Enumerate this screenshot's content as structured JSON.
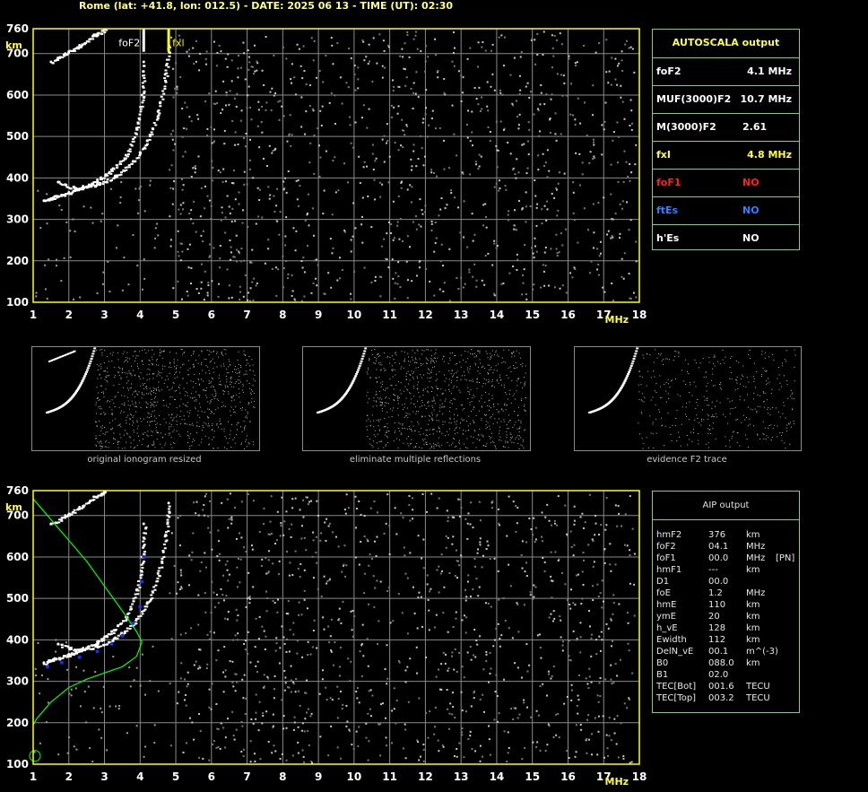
{
  "header": "Rome (lat: +41.8, lon: 012.5) - DATE: 2025 06 13 - TIME (UT): 02:30",
  "colors": {
    "frame": "#ffff00",
    "grid": "#8a8a8a",
    "trace": "#ffffff",
    "profile": "#00ff00",
    "blue": "#1a2cff",
    "table_border": "#7fd07f",
    "title": "#ffff40"
  },
  "chart_data": [
    {
      "type": "scatter",
      "name": "top-ionogram",
      "xlabel": "MHz",
      "ylabel": "km",
      "x_ticks": [
        "1",
        "2",
        "3",
        "4",
        "5",
        "6",
        "7",
        "8",
        "9",
        "10",
        "11",
        "12",
        "13",
        "14",
        "15",
        "16",
        "17",
        "18"
      ],
      "y_ticks": [
        "100",
        "200",
        "300",
        "400",
        "500",
        "600",
        "700",
        "760"
      ],
      "xlim": [
        1,
        18
      ],
      "ylim": [
        100,
        760
      ],
      "grid": true,
      "markers": [
        {
          "label": "foF2",
          "freq": 4.1,
          "color": "#ffffff"
        },
        {
          "label": "fxl",
          "freq": 4.8,
          "color": "#ffff00"
        }
      ],
      "traces": [
        {
          "label": "o-trace",
          "points": [
            [
              1.3,
              345
            ],
            [
              1.6,
              355
            ],
            [
              2.0,
              365
            ],
            [
              2.4,
              380
            ],
            [
              2.8,
              395
            ],
            [
              3.2,
              420
            ],
            [
              3.6,
              455
            ],
            [
              3.9,
              520
            ],
            [
              4.05,
              600
            ],
            [
              4.1,
              680
            ]
          ]
        },
        {
          "label": "x-trace",
          "points": [
            [
              1.7,
              390
            ],
            [
              2.2,
              375
            ],
            [
              2.8,
              385
            ],
            [
              3.3,
              405
            ],
            [
              3.8,
              440
            ],
            [
              4.2,
              490
            ],
            [
              4.5,
              560
            ],
            [
              4.7,
              650
            ],
            [
              4.8,
              730
            ]
          ]
        },
        {
          "label": "multiple",
          "points": [
            [
              1.5,
              680
            ],
            [
              1.9,
              700
            ],
            [
              2.3,
              720
            ],
            [
              2.7,
              745
            ],
            [
              3.0,
              758
            ]
          ]
        }
      ]
    },
    {
      "type": "scatter",
      "name": "bottom-ionogram-aip",
      "xlabel": "MHz",
      "ylabel": "km",
      "x_ticks": [
        "1",
        "2",
        "3",
        "4",
        "5",
        "6",
        "7",
        "8",
        "9",
        "10",
        "11",
        "12",
        "13",
        "14",
        "15",
        "16",
        "17",
        "18"
      ],
      "y_ticks": [
        "100",
        "200",
        "300",
        "400",
        "500",
        "600",
        "700",
        "760"
      ],
      "xlim": [
        1,
        18
      ],
      "ylim": [
        100,
        760
      ],
      "grid": true,
      "traces": [
        {
          "label": "o-trace",
          "points": [
            [
              1.3,
              345
            ],
            [
              1.6,
              355
            ],
            [
              2.0,
              365
            ],
            [
              2.4,
              380
            ],
            [
              2.8,
              395
            ],
            [
              3.2,
              420
            ],
            [
              3.6,
              455
            ],
            [
              3.9,
              520
            ],
            [
              4.05,
              600
            ],
            [
              4.1,
              680
            ]
          ]
        },
        {
          "label": "x-trace",
          "points": [
            [
              1.7,
              390
            ],
            [
              2.2,
              375
            ],
            [
              2.8,
              385
            ],
            [
              3.3,
              405
            ],
            [
              3.8,
              440
            ],
            [
              4.2,
              490
            ],
            [
              4.5,
              560
            ],
            [
              4.7,
              650
            ],
            [
              4.8,
              730
            ]
          ]
        },
        {
          "label": "multiple",
          "points": [
            [
              1.5,
              680
            ],
            [
              1.9,
              700
            ],
            [
              2.3,
              720
            ],
            [
              2.7,
              745
            ],
            [
              3.0,
              758
            ]
          ]
        }
      ],
      "blue_points": [
        [
          1.4,
          335
        ],
        [
          1.8,
          345
        ],
        [
          2.3,
          358
        ],
        [
          2.8,
          372
        ],
        [
          3.2,
          390
        ],
        [
          3.5,
          410
        ],
        [
          3.8,
          440
        ],
        [
          4.0,
          480
        ],
        [
          4.05,
          540
        ],
        [
          4.1,
          600
        ]
      ],
      "profile": [
        [
          1.0,
          740
        ],
        [
          1.5,
          690
        ],
        [
          2.0,
          640
        ],
        [
          2.5,
          590
        ],
        [
          3.0,
          530
        ],
        [
          3.5,
          470
        ],
        [
          3.9,
          420
        ],
        [
          4.05,
          395
        ],
        [
          3.9,
          360
        ],
        [
          3.5,
          335
        ],
        [
          3.0,
          320
        ],
        [
          2.5,
          305
        ],
        [
          2.0,
          285
        ],
        [
          1.5,
          250
        ],
        [
          1.1,
          210
        ],
        [
          1.0,
          195
        ]
      ]
    }
  ],
  "autoscala": {
    "title": "AUTOSCALA output",
    "rows": [
      {
        "key": "foF2",
        "value": "4.1 MHz",
        "key_color": "#ffffff",
        "value_color": "#ffffff"
      },
      {
        "key": "MUF(3000)F2",
        "value": "10.7 MHz",
        "key_color": "#ffffff",
        "value_color": "#ffffff"
      },
      {
        "key": "M(3000)F2",
        "value": "2.61",
        "key_color": "#ffffff",
        "value_color": "#ffffff"
      },
      {
        "key": "fxI",
        "value": "4.8 MHz",
        "key_color": "#ffff40",
        "value_color": "#ffff40"
      },
      {
        "key": "foF1",
        "value": "NO",
        "key_color": "#ff2020",
        "value_color": "#ff2020"
      },
      {
        "key": "ftEs",
        "value": "NO",
        "key_color": "#3080ff",
        "value_color": "#3080ff"
      },
      {
        "key": "h'Es",
        "value": "NO",
        "key_color": "#ffffff",
        "value_color": "#ffffff"
      }
    ]
  },
  "thumbs": [
    {
      "caption": "original ionogram resized"
    },
    {
      "caption": "eliminate multiple reflections"
    },
    {
      "caption": "evidence F2 trace"
    }
  ],
  "aip": {
    "title": "AIP output",
    "rows": [
      [
        "hmF2",
        "376",
        "km",
        ""
      ],
      [
        "foF2",
        "04.1",
        "MHz",
        ""
      ],
      [
        "foF1",
        "00.0",
        "MHz",
        "[PN]"
      ],
      [
        "hmF1",
        "---",
        "km",
        ""
      ],
      [
        "D1",
        "00.0",
        "",
        ""
      ],
      [
        "foE",
        "1.2",
        "MHz",
        ""
      ],
      [
        "hmE",
        "110",
        "km",
        ""
      ],
      [
        "ymE",
        "20",
        "km",
        ""
      ],
      [
        "h_vE",
        "128",
        "km",
        ""
      ],
      [
        "Ewidth",
        "112",
        "km",
        ""
      ],
      [
        "DelN_vE",
        "00.1",
        "m^(-3)",
        ""
      ],
      [
        "B0",
        "088.0",
        "km",
        ""
      ],
      [
        "B1",
        "02.0",
        "",
        ""
      ],
      [
        "TEC[Bot]",
        "001.6",
        "TECU",
        ""
      ],
      [
        "TEC[Top]",
        "003.2",
        "TECU",
        ""
      ]
    ]
  }
}
